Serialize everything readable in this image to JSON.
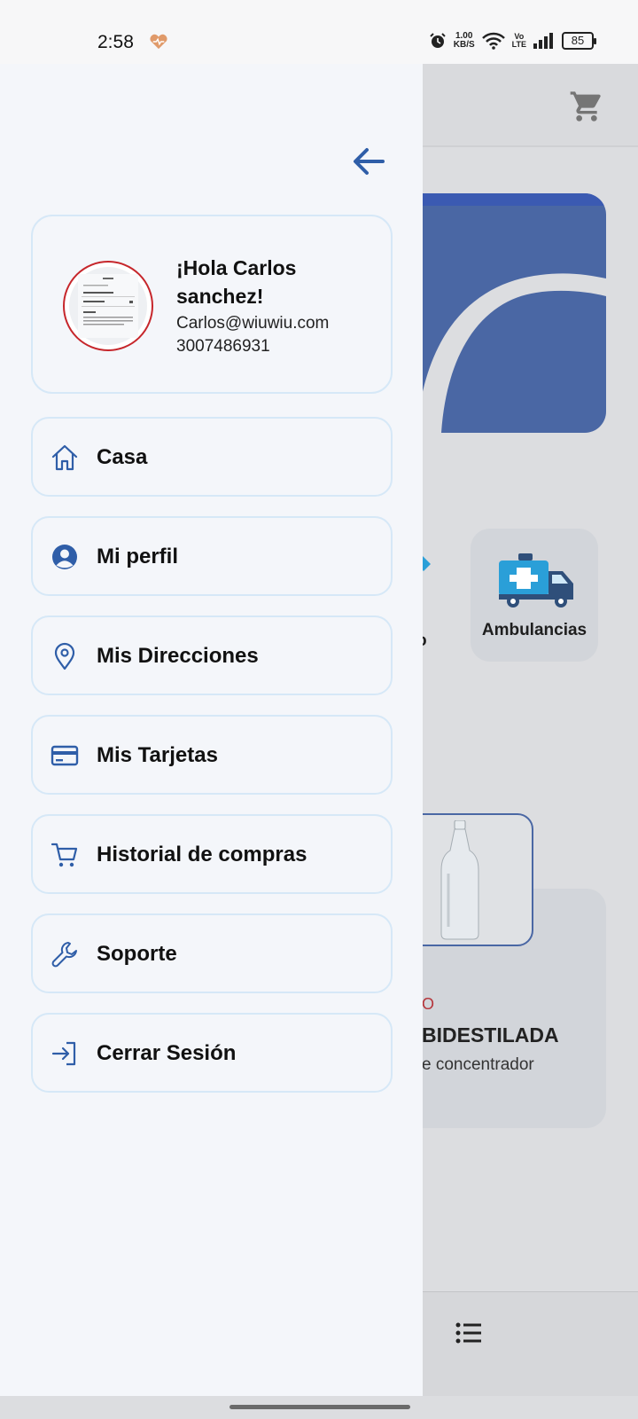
{
  "status_bar": {
    "time": "2:58",
    "net_speed_value": "1.00",
    "net_speed_unit": "KB/S",
    "volte_top": "Vo",
    "volte_bottom": "LTE",
    "battery": "85"
  },
  "drawer": {
    "profile": {
      "greeting": "¡Hola Carlos sanchez!",
      "email": "Carlos@wiuwiu.com",
      "phone": "3007486931"
    },
    "menu": [
      {
        "label": "Casa",
        "icon": "home-icon"
      },
      {
        "label": "Mi perfil",
        "icon": "user-circle-icon"
      },
      {
        "label": "Mis Direcciones",
        "icon": "location-pin-icon"
      },
      {
        "label": "Mis Tarjetas",
        "icon": "credit-card-icon"
      },
      {
        "label": "Historial de compras",
        "icon": "cart-icon"
      },
      {
        "label": "Soporte",
        "icon": "wrench-icon"
      },
      {
        "label": "Cerrar Sesión",
        "icon": "logout-icon"
      }
    ]
  },
  "background": {
    "category_partial": "o",
    "category_ambulance": "Ambulancias",
    "product_tag": "O",
    "product_name": "BIDESTILADA",
    "product_desc": "e concentrador"
  },
  "colors": {
    "accent": "#2f5ea8",
    "card_border": "#d6e8f7",
    "drawer_bg": "#f4f6fa",
    "avatar_ring": "#c6262b",
    "banner": "#4a67a4"
  }
}
